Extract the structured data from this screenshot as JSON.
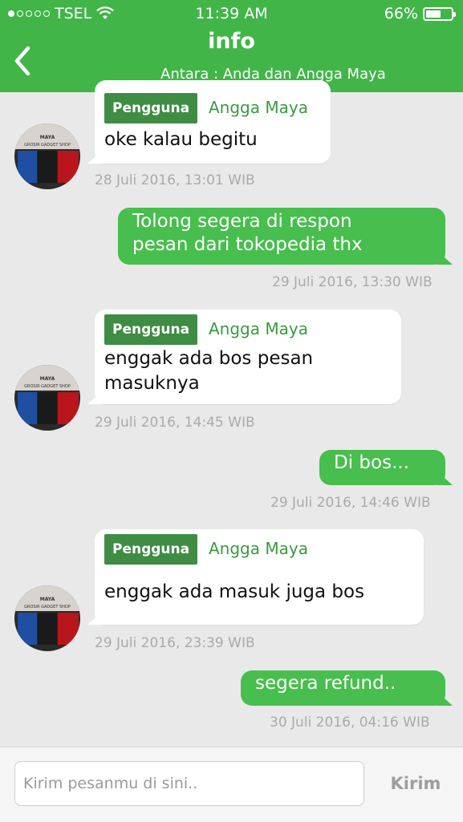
{
  "status_bar": {
    "carrier": "TSEL",
    "time": "11:39 AM",
    "battery": "66%",
    "battery_level": 0.66,
    "signal_bars": 1,
    "icons": [
      "signal-dots-icon",
      "wifi-icon",
      "battery-icon"
    ]
  },
  "header": {
    "title": "info",
    "subtitle": "Antara : Anda dan Angga Maya",
    "back_icon": "chevron-left-icon"
  },
  "avatar": {
    "line1": "MAYA",
    "line2": "GROSIR GADGET SHOP"
  },
  "messages": [
    {
      "direction": "incoming",
      "badge": "Pengguna",
      "sender": "Angga Maya",
      "lines": [
        "oke kalau begitu"
      ],
      "timestamp": "28 Juli 2016, 13:01 WIB"
    },
    {
      "direction": "outgoing",
      "lines": [
        "Tolong segera di respon",
        "pesan dari tokopedia thx"
      ],
      "timestamp": "29 Juli 2016, 13:30 WIB"
    },
    {
      "direction": "incoming",
      "badge": "Pengguna",
      "sender": "Angga Maya",
      "lines": [
        "enggak ada bos pesan",
        "masuknya"
      ],
      "timestamp": "29 Juli 2016, 14:45 WIB"
    },
    {
      "direction": "outgoing",
      "lines": [
        "Di  bos..."
      ],
      "timestamp": "29 Juli 2016, 14:46 WIB"
    },
    {
      "direction": "incoming",
      "badge": "Pengguna",
      "sender": "Angga Maya",
      "lines": [
        "enggak ada  masuk juga bos"
      ],
      "timestamp": "29 Juli 2016, 23:39 WIB"
    },
    {
      "direction": "outgoing",
      "lines": [
        "segera refund.."
      ],
      "timestamp": "30 Juli 2016, 04:16 WIB"
    }
  ],
  "composer": {
    "placeholder": "Kirim pesanmu di sini..",
    "value": "",
    "send_label": "Kirim"
  },
  "colors": {
    "brand_green": "#42b549",
    "outgoing_bubble": "#47be4d",
    "badge_green": "#3f8c45",
    "sender_green": "#3a9a3f",
    "background": "#e9e9e9",
    "timestamp": "#aaaaaa"
  }
}
